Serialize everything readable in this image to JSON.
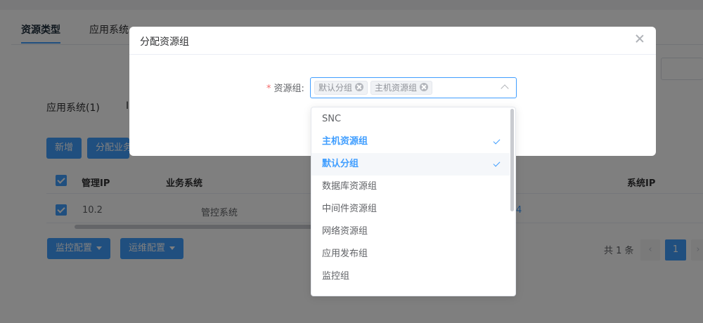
{
  "tabs": [
    {
      "label": "资源类型",
      "active": true
    },
    {
      "label": "应用系统",
      "active": false
    }
  ],
  "section": {
    "title": "应用系统(1)",
    "title2": "I"
  },
  "toolbar": {
    "add_label": "新增",
    "assign_label": "分配业务"
  },
  "table": {
    "headers": [
      "管理IP",
      "业务系统",
      "系统IP"
    ],
    "rows": [
      {
        "ip": "10.2",
        "system": "管控系统",
        "extra": "4"
      }
    ]
  },
  "bottom_buttons": {
    "monitor_label": "监控配置",
    "ops_label": "运维配置"
  },
  "pagination": {
    "total_text": "共 1 条",
    "prev": "‹",
    "current": "1",
    "next": "›"
  },
  "dialog": {
    "title": "分配资源组",
    "field_label": "资源组:",
    "required_mark": "*",
    "selected_tags": [
      "默认分组",
      "主机资源组"
    ]
  },
  "dropdown": {
    "options": [
      {
        "label": "SNC",
        "selected": false
      },
      {
        "label": "主机资源组",
        "selected": true
      },
      {
        "label": "默认分组",
        "selected": true
      },
      {
        "label": "数据库资源组",
        "selected": false
      },
      {
        "label": "中间件资源组",
        "selected": false
      },
      {
        "label": "网络资源组",
        "selected": false
      },
      {
        "label": "应用发布组",
        "selected": false
      },
      {
        "label": "监控组",
        "selected": false
      }
    ]
  },
  "colors": {
    "primary": "#409eff",
    "required": "#f56c6c"
  }
}
